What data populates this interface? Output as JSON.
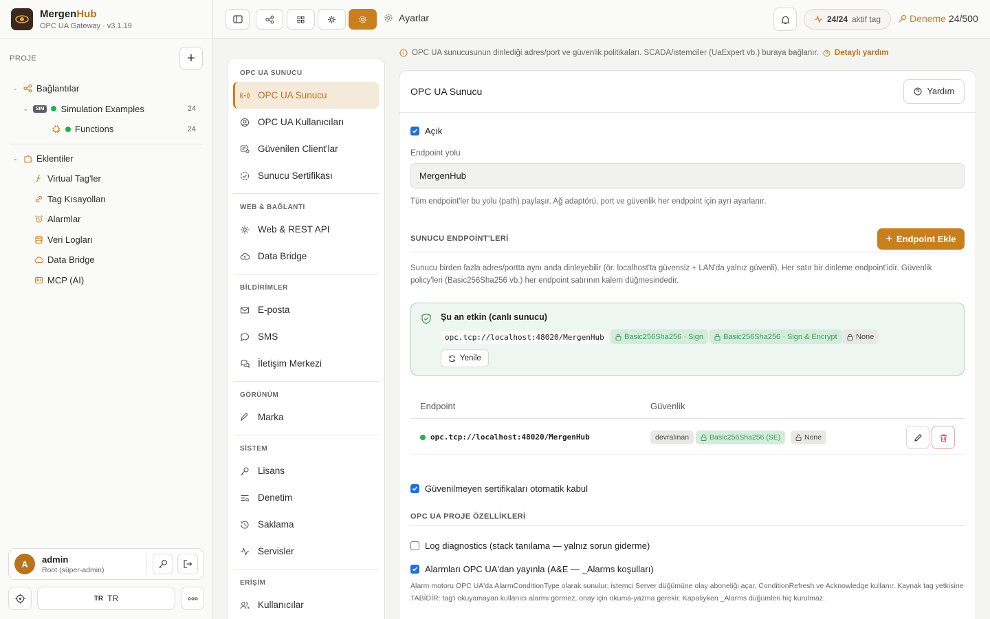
{
  "app": {
    "name_main": "Mergen",
    "name_accent": "Hub",
    "subtitle": "OPC UA Gateway · v3.1.19"
  },
  "sidebar": {
    "project_label": "PROJE",
    "connections": {
      "label": "Bağlantılar"
    },
    "simulation": {
      "badge": "SIM",
      "label": "Simulation Examples",
      "count": "24"
    },
    "functions": {
      "label": "Functions",
      "count": "24"
    },
    "plugins": {
      "label": "Eklentiler"
    },
    "plugin_items": [
      {
        "label": "Virtual Tag'ler",
        "icon": "function-icon"
      },
      {
        "label": "Tag Kısayolları",
        "icon": "link-icon"
      },
      {
        "label": "Alarmlar",
        "icon": "alarm-icon"
      },
      {
        "label": "Veri Logları",
        "icon": "database-icon"
      },
      {
        "label": "Data Bridge",
        "icon": "cloud-icon"
      },
      {
        "label": "MCP (AI)",
        "icon": "ai-icon"
      }
    ],
    "user": {
      "initial": "A",
      "name": "admin",
      "role": "Root (süper-admin)"
    },
    "lang": {
      "flag": "TR",
      "label": "TR"
    }
  },
  "topbar": {
    "breadcrumb": "Ayarlar",
    "tags_active": "24/24",
    "tags_suffix": "aktif tag",
    "trial_label": "Deneme",
    "trial_count": "24/500"
  },
  "settings_nav": {
    "sections": [
      {
        "title": "OPC UA SUNUCU",
        "items": [
          "OPC UA Sunucu",
          "OPC UA Kullanıcıları",
          "Güvenilen Client'lar",
          "Sunucu Sertifikası"
        ]
      },
      {
        "title": "WEB & BAĞLANTI",
        "items": [
          "Web & REST API",
          "Data Bridge"
        ]
      },
      {
        "title": "BİLDİRİMLER",
        "items": [
          "E-posta",
          "SMS",
          "İletişim Merkezi"
        ]
      },
      {
        "title": "GÖRÜNÜM",
        "items": [
          "Marka"
        ]
      },
      {
        "title": "SİSTEM",
        "items": [
          "Lisans",
          "Denetim",
          "Saklama",
          "Servisler"
        ]
      },
      {
        "title": "ERİŞİM",
        "items": [
          "Kullanıcılar"
        ]
      }
    ]
  },
  "main": {
    "info_text": "OPC UA sunucusunun dinlediği adres/port ve güvenlik politikaları. SCADA/istemciler (UaExpert vb.) buraya bağlanır.",
    "info_help": "Detaylı yardım",
    "card_title": "OPC UA Sunucu",
    "help_button": "Yardım",
    "enabled_label": "Açık",
    "endpoint_path_label": "Endpoint yolu",
    "endpoint_path_value": "MergenHub",
    "endpoint_path_hint": "Tüm endpoint'ler bu yolu (path) paylaşır. Ağ adaptörü, port ve güvenlik her endpoint için ayrı ayarlanır.",
    "endpoints_title": "SUNUCU ENDPOİNT'LERİ",
    "add_endpoint": "Endpoint Ekle",
    "endpoints_hint_1": "Sunucu birden fazla adres/portta aynı anda dinleyebilir (ör. localhost'ta güvensiz + LAN'da yalnız güvenli). Her satır bir dinleme endpoint'idir. Güvenlik",
    "endpoints_hint_2": "policy'leri (Basic256Sha256 vb.) her endpoint satırının kalem düğmesindedir.",
    "live": {
      "title": "Şu an etkin (canlı sunucu)",
      "url": "opc.tcp://localhost:48020/MergenHub",
      "policy_sign": "Basic256Sha256 · Sign",
      "policy_se": "Basic256Sha256 · Sign & Encrypt",
      "policy_none": "None",
      "refresh": "Yenile"
    },
    "table": {
      "col_endpoint": "Endpoint",
      "col_security": "Güvenlik",
      "row_url": "opc.tcp://localhost:48020/MergenHub",
      "row_inherited": "devralınan",
      "row_policy": "Basic256Sha256 (SE)",
      "row_none": "None"
    },
    "auto_accept_label": "Güvenilmeyen sertifikaları otomatik kabul",
    "project_props_title": "OPC UA PROJE ÖZELLİKLERİ",
    "log_diag_label": "Log diagnostics (stack tanılama — yalnız sorun giderme)",
    "alarms_label": "Alarmları OPC UA'dan yayınla (A&E — _Alarms koşulları)",
    "alarms_hint_1": "Alarm motoru OPC UA'da AlarmConditionType olarak sunulur; istemci Server düğümüne olay aboneliği açar, ConditionRefresh ve Acknowledge kullanır. Kaynak tag yetkisine",
    "alarms_hint_2": "TABİDİR: tag'i okuyamayan kullanıcı alarmı görmez, onay için okuma-yazma gerekir. Kapalıyken _Alarms düğümleri hiç kurulmaz."
  },
  "colors": {
    "accent": "#c8801e",
    "green": "#22b24c",
    "check": "#1f6fe0"
  }
}
